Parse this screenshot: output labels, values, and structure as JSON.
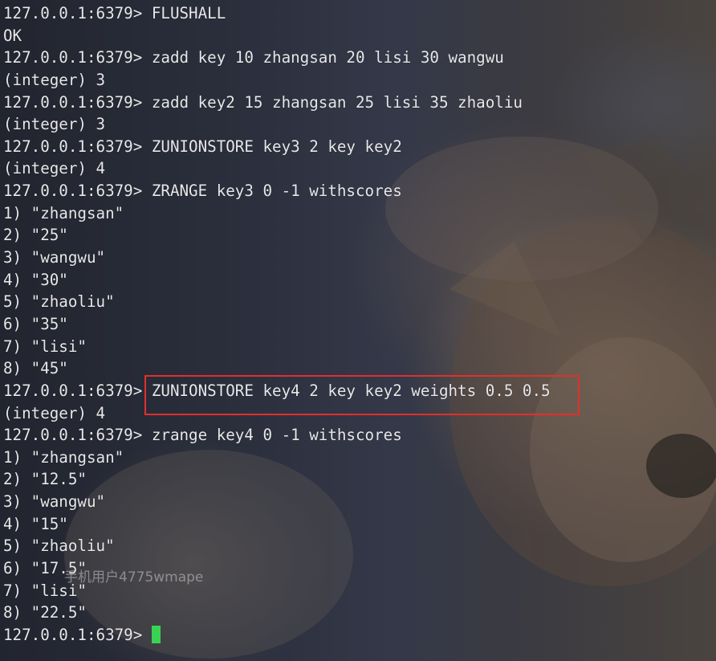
{
  "terminal": {
    "lines": [
      {
        "prompt": "127.0.0.1:6379> ",
        "text": "FLUSHALL"
      },
      {
        "prompt": "",
        "text": "OK"
      },
      {
        "prompt": "127.0.0.1:6379> ",
        "text": "zadd key 10 zhangsan 20 lisi 30 wangwu"
      },
      {
        "prompt": "",
        "text": "(integer) 3"
      },
      {
        "prompt": "127.0.0.1:6379> ",
        "text": "zadd key2 15 zhangsan 25 lisi 35 zhaoliu"
      },
      {
        "prompt": "",
        "text": "(integer) 3"
      },
      {
        "prompt": "127.0.0.1:6379> ",
        "text": "ZUNIONSTORE key3 2 key key2"
      },
      {
        "prompt": "",
        "text": "(integer) 4"
      },
      {
        "prompt": "127.0.0.1:6379> ",
        "text": "ZRANGE key3 0 -1 withscores"
      },
      {
        "prompt": "",
        "text": "1) \"zhangsan\""
      },
      {
        "prompt": "",
        "text": "2) \"25\""
      },
      {
        "prompt": "",
        "text": "3) \"wangwu\""
      },
      {
        "prompt": "",
        "text": "4) \"30\""
      },
      {
        "prompt": "",
        "text": "5) \"zhaoliu\""
      },
      {
        "prompt": "",
        "text": "6) \"35\""
      },
      {
        "prompt": "",
        "text": "7) \"lisi\""
      },
      {
        "prompt": "",
        "text": "8) \"45\""
      },
      {
        "prompt": "127.0.0.1:6379> ",
        "text": "ZUNIONSTORE key4 2 key key2 weights 0.5 0.5"
      },
      {
        "prompt": "",
        "text": "(integer) 4"
      },
      {
        "prompt": "127.0.0.1:6379> ",
        "text": "zrange key4 0 -1 withscores"
      },
      {
        "prompt": "",
        "text": "1) \"zhangsan\""
      },
      {
        "prompt": "",
        "text": "2) \"12.5\""
      },
      {
        "prompt": "",
        "text": "3) \"wangwu\""
      },
      {
        "prompt": "",
        "text": "4) \"15\""
      },
      {
        "prompt": "",
        "text": "5) \"zhaoliu\""
      },
      {
        "prompt": "",
        "text": "6) \"17.5\""
      },
      {
        "prompt": "",
        "text": "7) \"lisi\""
      },
      {
        "prompt": "",
        "text": "8) \"22.5\""
      }
    ],
    "current_prompt": "127.0.0.1:6379> ",
    "cursor_color": "#39d353",
    "highlight_color": "#e0302c",
    "highlighted_line": 17
  },
  "watermark": "手机用户4775wmape",
  "background_image": "kitten-photo"
}
